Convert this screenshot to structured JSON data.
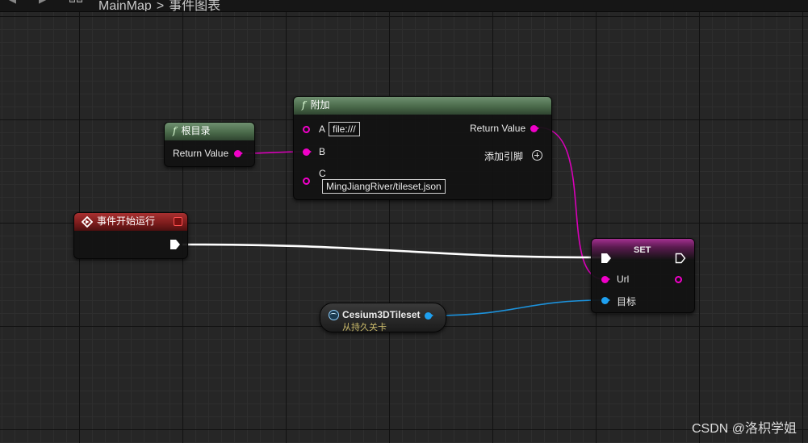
{
  "toolbar": {
    "breadcrumb_root": "MainMap",
    "breadcrumb_separator": ">",
    "breadcrumb_current": "事件图表"
  },
  "nodes": {
    "root_dir": {
      "title": "根目录",
      "output_label": "Return Value"
    },
    "append": {
      "title": "附加",
      "pin_a": "A",
      "pin_a_value": "file:///",
      "pin_b": "B",
      "pin_c": "C",
      "pin_c_value": "MingJiangRiver/tileset.json",
      "output_label": "Return Value",
      "add_pin_label": "添加引脚"
    },
    "begin_play": {
      "title": "事件开始运行"
    },
    "set": {
      "title": "SET",
      "pin_url": "Url",
      "pin_target": "目标"
    },
    "tileset_ref": {
      "title": "Cesium3DTileset",
      "subtitle": "从持久关卡"
    }
  },
  "colors": {
    "string_pin": "#f000c8",
    "object_pin": "#1ea0f0",
    "exec_wire": "#ffffff",
    "function_header": "#4a6a4a",
    "event_header": "#7a1b1b"
  },
  "watermark": "CSDN @洛枳学姐"
}
